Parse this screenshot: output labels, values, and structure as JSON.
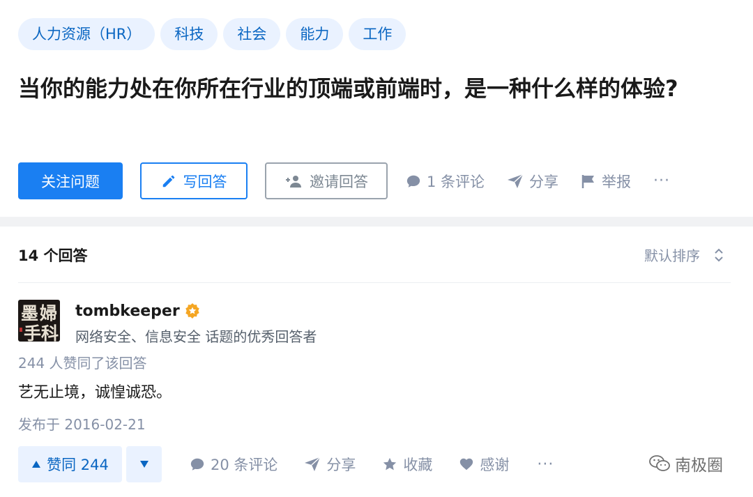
{
  "topics": [
    "人力资源（HR）",
    "科技",
    "社会",
    "能力",
    "工作"
  ],
  "question": {
    "title": "当你的能力处在你所在行业的顶端或前端时，是一种什么样的体验?"
  },
  "question_actions": {
    "follow_label": "关注问题",
    "write_label": "写回答",
    "invite_label": "邀请回答",
    "comment_label": "1 条评论",
    "share_label": "分享",
    "report_label": "举报",
    "more_label": "···",
    "primary_color": "#1a7ff2"
  },
  "answers_header": {
    "count_label": "14 个回答",
    "sort_label": "默认排序"
  },
  "answer": {
    "author": {
      "name": "tombkeeper",
      "description": "网络安全、信息安全 话题的优秀回答者",
      "avatar_chars": [
        "墨",
        "婦",
        "手",
        "科"
      ],
      "badge_icon": "gold-star-badge-icon",
      "badge_color": "#f5a623"
    },
    "votes_text": "244 人赞同了该回答",
    "content": "艺无止境，诚惶诚恐。",
    "published": "发布于 2016-02-21",
    "actions": {
      "upvote_label": "赞同 244",
      "comment_label": "20 条评论",
      "share_label": "分享",
      "collect_label": "收藏",
      "thanks_label": "感谢",
      "more_label": "···"
    }
  },
  "watermark": {
    "text": "南极圈"
  }
}
